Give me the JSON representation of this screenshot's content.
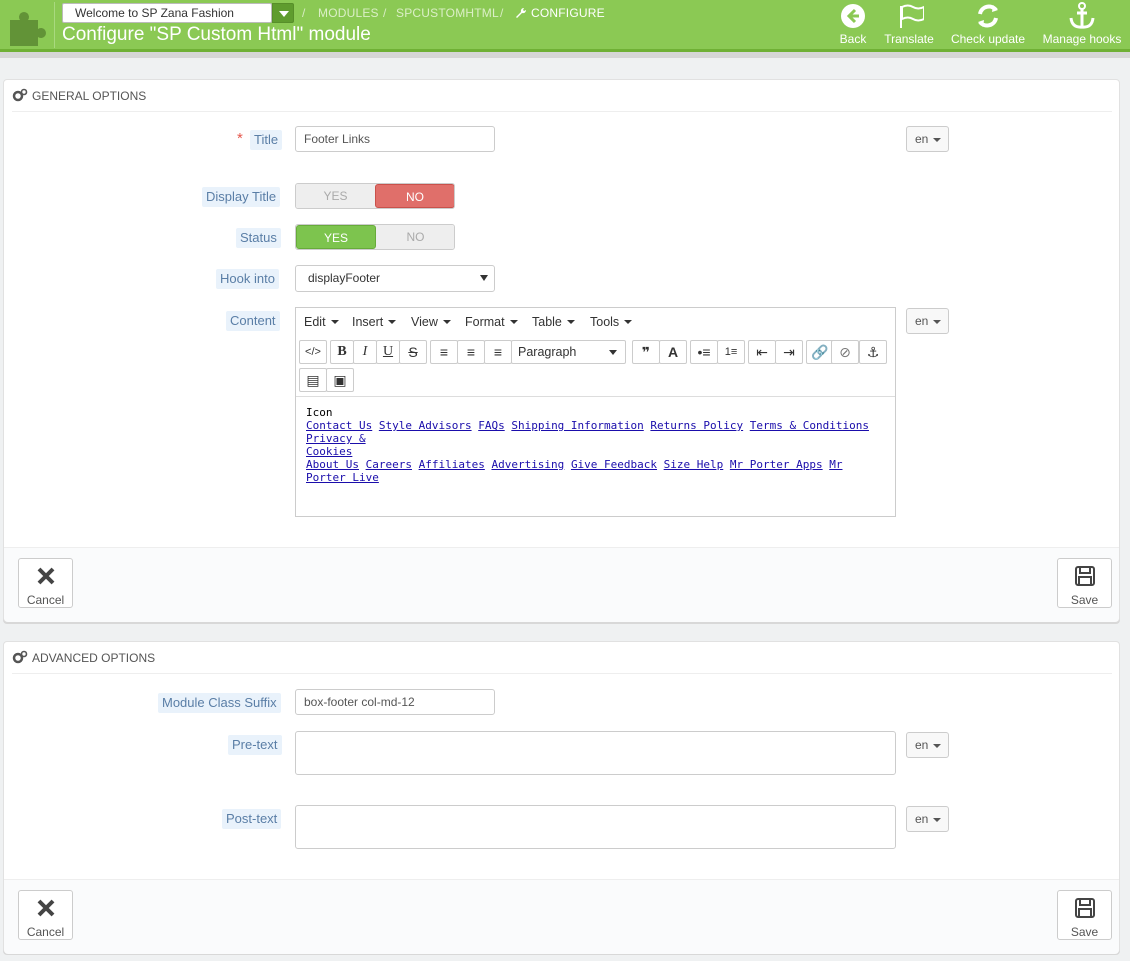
{
  "header": {
    "shop_select": "Welcome to SP Zana Fashion",
    "breadcrumb": [
      "MODULES",
      "SPCUSTOMHTML",
      "CONFIGURE"
    ],
    "title": "Configure \"SP Custom Html\" module",
    "toolbar": {
      "back": "Back",
      "translate": "Translate",
      "check_update": "Check update",
      "manage_hooks": "Manage hooks"
    },
    "colors": {
      "bar": "#8bc954",
      "bar_border": "#6fb035"
    }
  },
  "general": {
    "heading": "GENERAL OPTIONS",
    "title_label": "Title",
    "title_value": "Footer Links",
    "lang": "en",
    "display_title_label": "Display Title",
    "status_label": "Status",
    "yes": "YES",
    "no": "NO",
    "display_title_value": "NO",
    "status_value": "YES",
    "hook_label": "Hook into",
    "hook_value": "displayFooter",
    "content_label": "Content",
    "editor": {
      "menus": [
        "Edit",
        "Insert",
        "View",
        "Format",
        "Table",
        "Tools"
      ],
      "paragraph": "Paragraph",
      "icons": [
        "code-icon",
        "bold-icon",
        "italic-icon",
        "underline-icon",
        "strikethrough-icon",
        "align-left-icon",
        "align-center-icon",
        "align-right-icon",
        "blockquote-icon",
        "text-color-icon",
        "bullet-list-icon",
        "numbered-list-icon",
        "outdent-icon",
        "indent-icon",
        "link-icon",
        "unlink-icon",
        "anchor-icon",
        "media-icon",
        "image-icon"
      ],
      "first_line": "Icon",
      "links_row1": [
        "Contact Us",
        "Style Advisors",
        "FAQs",
        "Shipping Information",
        "Returns Policy",
        "Terms & Conditions",
        "Privacy &"
      ],
      "links_row2": [
        "Cookies"
      ],
      "links_row3": [
        "About Us",
        "Careers",
        "Affiliates",
        "Advertising",
        "Give Feedback",
        "Size Help",
        "Mr Porter Apps",
        "Mr Porter Live"
      ]
    },
    "cancel": "Cancel",
    "save": "Save"
  },
  "advanced": {
    "heading": "ADVANCED OPTIONS",
    "suffix_label": "Module Class Suffix",
    "suffix_value": "box-footer col-md-12",
    "pretext_label": "Pre-text",
    "posttext_label": "Post-text",
    "lang": "en",
    "cancel": "Cancel",
    "save": "Save"
  }
}
